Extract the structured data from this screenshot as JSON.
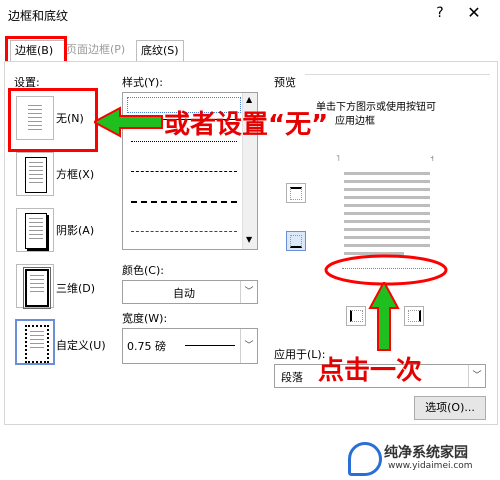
{
  "window": {
    "title": "边框和底纹",
    "help": "?",
    "close": "✕"
  },
  "tabs": [
    {
      "label": "边框(B)",
      "active": true
    },
    {
      "label": "页面边框(P)",
      "active": false
    },
    {
      "label": "底纹(S)",
      "active": false
    }
  ],
  "settings": {
    "heading": "设置:",
    "presets": [
      {
        "label": "无(N)"
      },
      {
        "label": "方框(X)"
      },
      {
        "label": "阴影(A)"
      },
      {
        "label": "三维(D)"
      },
      {
        "label": "自定义(U)"
      }
    ]
  },
  "style": {
    "heading": "样式(Y):",
    "color_label": "颜色(C):",
    "color_value": "自动",
    "width_label": "宽度(W):",
    "width_value": "0.75 磅"
  },
  "preview": {
    "heading": "预览",
    "hint_line1": "单击下方图示或使用按钮可",
    "hint_line2": "应用边框",
    "apply_label": "应用于(L):",
    "apply_value": "段落",
    "options_button": "选项(O)..."
  },
  "annotations": {
    "left_text": "或者设置“无”",
    "right_text": "点击一次",
    "color": "#e60000"
  },
  "watermark": {
    "text": "纯净系统家园",
    "url": "www.yidaimei.com"
  }
}
